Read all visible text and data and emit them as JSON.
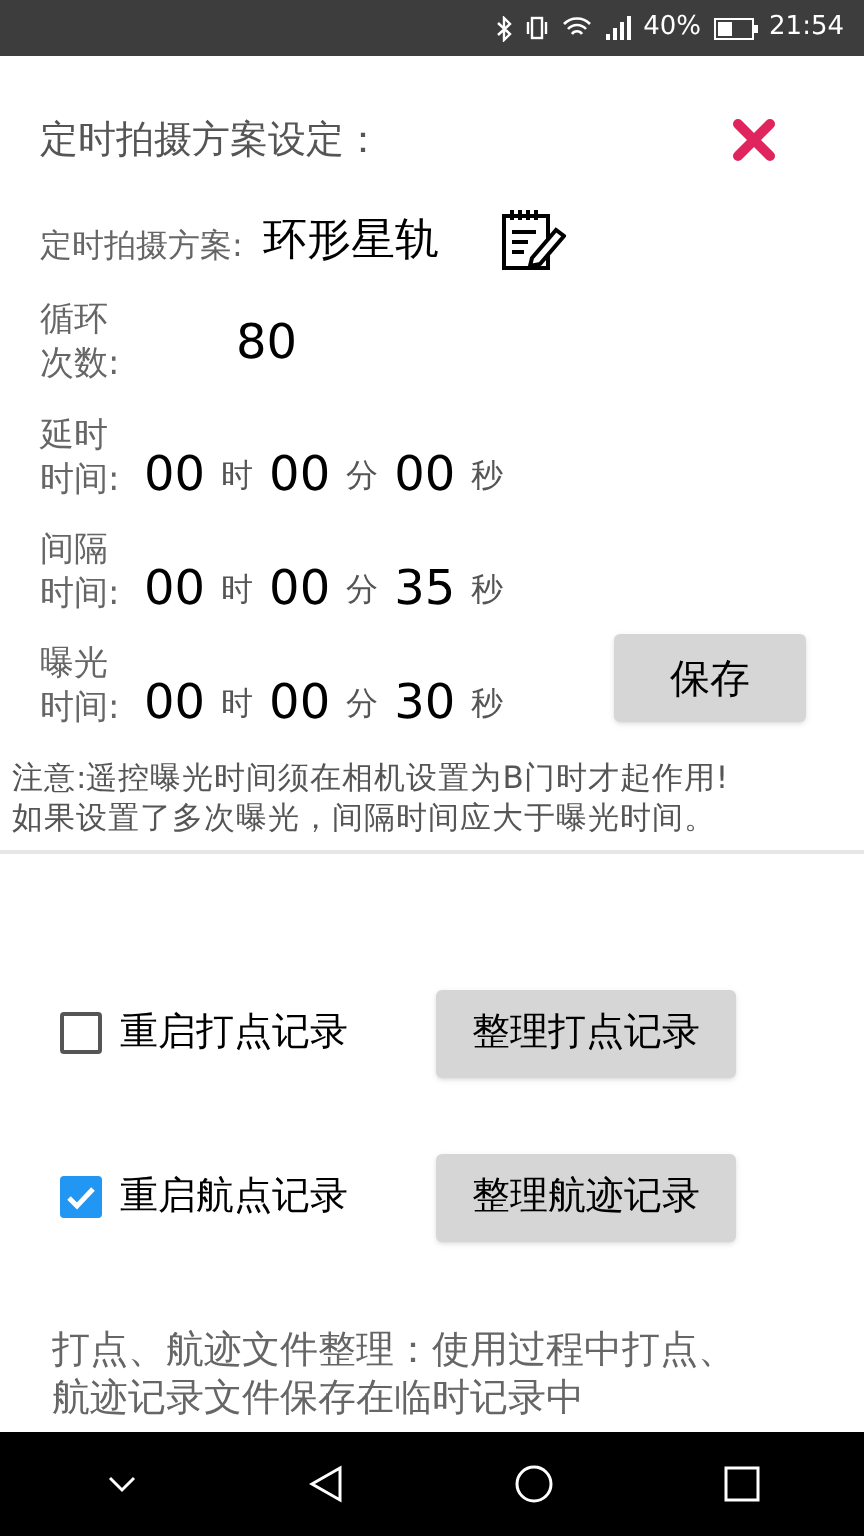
{
  "status_bar": {
    "battery": "40%",
    "time": "21:54"
  },
  "title": "定时拍摄方案设定：",
  "plan": {
    "label": "定时拍摄方案:",
    "value": "环形星轨"
  },
  "cycles": {
    "label": [
      "循环",
      "次数:"
    ],
    "value": "80"
  },
  "times": [
    {
      "label": [
        "延时",
        "时间:"
      ],
      "parts": [
        {
          "value": "00",
          "unit": "时"
        },
        {
          "value": "00",
          "unit": "分"
        },
        {
          "value": "00",
          "unit": "秒"
        }
      ]
    },
    {
      "label": [
        "间隔",
        "时间:"
      ],
      "parts": [
        {
          "value": "00",
          "unit": "时"
        },
        {
          "value": "00",
          "unit": "分"
        },
        {
          "value": "35",
          "unit": "秒"
        }
      ]
    },
    {
      "label": [
        "曝光",
        "时间:"
      ],
      "parts": [
        {
          "value": "00",
          "unit": "时"
        },
        {
          "value": "00",
          "unit": "分"
        },
        {
          "value": "30",
          "unit": "秒"
        }
      ]
    }
  ],
  "save_button": "保存",
  "notes": [
    "注意:遥控曝光时间须在相机设置为B门时才起作用!",
    "如果设置了多次曝光，间隔时间应大于曝光时间。"
  ],
  "records": [
    {
      "label": "重启打点记录",
      "checked": false,
      "button": "整理打点记录"
    },
    {
      "label": "重启航点记录",
      "checked": true,
      "button": "整理航迹记录"
    }
  ],
  "help": "打点、航迹文件整理：使用过程中打点、航迹记录文件保存在临时记录中"
}
